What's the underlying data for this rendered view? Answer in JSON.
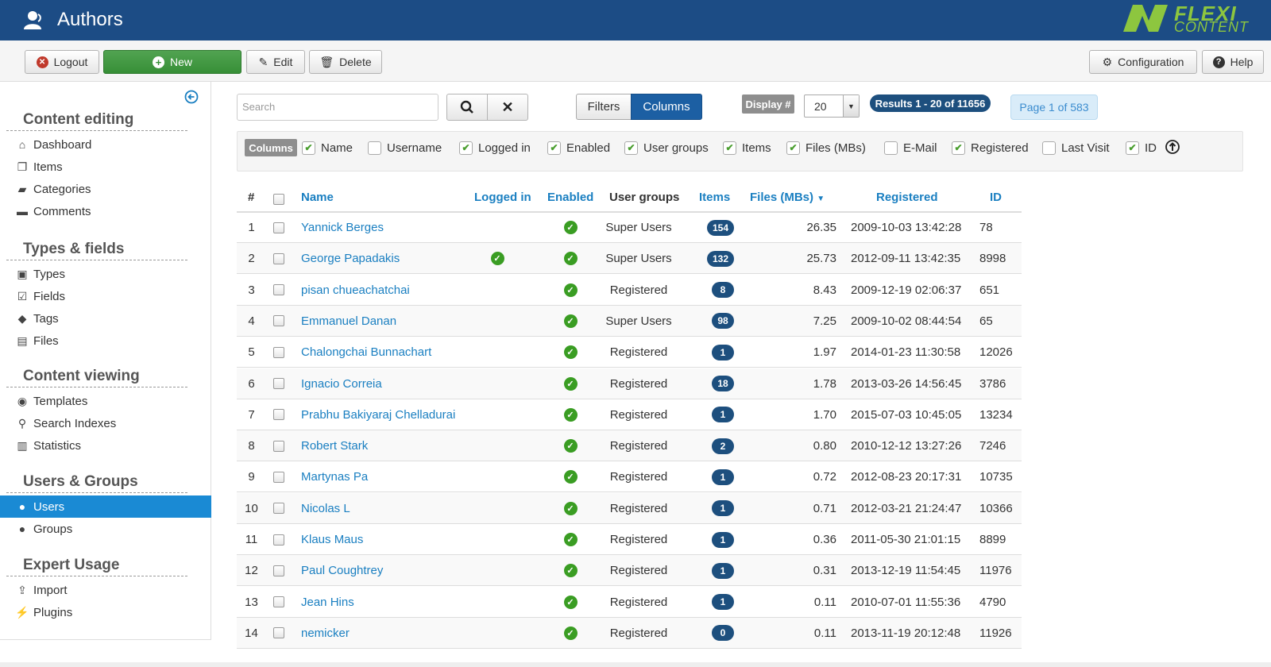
{
  "header": {
    "title": "Authors",
    "logo_top": "FLEXI",
    "logo_bottom": "CONTENT"
  },
  "toolbar": {
    "logout": "Logout",
    "new": "New",
    "edit": "Edit",
    "delete": "Delete",
    "configuration": "Configuration",
    "help": "Help"
  },
  "sidebar": {
    "sections": [
      {
        "title": "Content editing",
        "items": [
          {
            "label": "Dashboard",
            "icon": "home-icon"
          },
          {
            "label": "Items",
            "icon": "copy-icon"
          },
          {
            "label": "Categories",
            "icon": "folder-icon"
          },
          {
            "label": "Comments",
            "icon": "comment-icon"
          }
        ]
      },
      {
        "title": "Types & fields",
        "items": [
          {
            "label": "Types",
            "icon": "briefcase-icon"
          },
          {
            "label": "Fields",
            "icon": "checkbox-icon"
          },
          {
            "label": "Tags",
            "icon": "tags-icon"
          },
          {
            "label": "Files",
            "icon": "image-icon"
          }
        ]
      },
      {
        "title": "Content viewing",
        "items": [
          {
            "label": "Templates",
            "icon": "eye-icon"
          },
          {
            "label": "Search Indexes",
            "icon": "search-icon"
          },
          {
            "label": "Statistics",
            "icon": "chart-icon"
          }
        ]
      },
      {
        "title": "Users & Groups",
        "items": [
          {
            "label": "Users",
            "icon": "user-icon",
            "active": true
          },
          {
            "label": "Groups",
            "icon": "users-icon"
          }
        ]
      },
      {
        "title": "Expert Usage",
        "items": [
          {
            "label": "Import",
            "icon": "upload-icon"
          },
          {
            "label": "Plugins",
            "icon": "plug-icon"
          }
        ]
      }
    ]
  },
  "search": {
    "placeholder": "Search"
  },
  "view": {
    "filters": "Filters",
    "columns": "Columns"
  },
  "display": {
    "label": "Display #",
    "value": "20"
  },
  "results": {
    "text": "Results 1 - 20 of 11656",
    "page": "Page 1 of 583"
  },
  "columns_bar": {
    "label": "Columns",
    "options": [
      {
        "label": "Name",
        "checked": true
      },
      {
        "label": "Username",
        "checked": false
      },
      {
        "label": "Logged in",
        "checked": true
      },
      {
        "label": "Enabled",
        "checked": true
      },
      {
        "label": "User groups",
        "checked": true
      },
      {
        "label": "Items",
        "checked": true
      },
      {
        "label": "Files (MBs)",
        "checked": true
      },
      {
        "label": "E-Mail",
        "checked": false
      },
      {
        "label": "Registered",
        "checked": true
      },
      {
        "label": "Last Visit",
        "checked": false
      },
      {
        "label": "ID",
        "checked": true
      }
    ]
  },
  "table": {
    "headers": {
      "num": "#",
      "name": "Name",
      "logged": "Logged in",
      "enabled": "Enabled",
      "groups": "User groups",
      "items": "Items",
      "files": "Files (MBs)",
      "registered": "Registered",
      "id": "ID"
    },
    "rows": [
      {
        "num": "1",
        "name": "Yannick Berges",
        "logged": false,
        "enabled": true,
        "group": "Super Users",
        "items": "154",
        "files": "26.35",
        "registered": "2009-10-03 13:42:28",
        "id": "78"
      },
      {
        "num": "2",
        "name": "George Papadakis",
        "logged": true,
        "enabled": true,
        "group": "Super Users",
        "items": "132",
        "files": "25.73",
        "registered": "2012-09-11 13:42:35",
        "id": "8998"
      },
      {
        "num": "3",
        "name": "pisan chueachatchai",
        "logged": false,
        "enabled": true,
        "group": "Registered",
        "items": "8",
        "files": "8.43",
        "registered": "2009-12-19 02:06:37",
        "id": "651"
      },
      {
        "num": "4",
        "name": "Emmanuel Danan",
        "logged": false,
        "enabled": true,
        "group": "Super Users",
        "items": "98",
        "files": "7.25",
        "registered": "2009-10-02 08:44:54",
        "id": "65"
      },
      {
        "num": "5",
        "name": "Chalongchai Bunnachart",
        "logged": false,
        "enabled": true,
        "group": "Registered",
        "items": "1",
        "files": "1.97",
        "registered": "2014-01-23 11:30:58",
        "id": "12026"
      },
      {
        "num": "6",
        "name": "Ignacio Correia",
        "logged": false,
        "enabled": true,
        "group": "Registered",
        "items": "18",
        "files": "1.78",
        "registered": "2013-03-26 14:56:45",
        "id": "3786"
      },
      {
        "num": "7",
        "name": "Prabhu Bakiyaraj Chelladurai",
        "logged": false,
        "enabled": true,
        "group": "Registered",
        "items": "1",
        "files": "1.70",
        "registered": "2015-07-03 10:45:05",
        "id": "13234"
      },
      {
        "num": "8",
        "name": "Robert Stark",
        "logged": false,
        "enabled": true,
        "group": "Registered",
        "items": "2",
        "files": "0.80",
        "registered": "2010-12-12 13:27:26",
        "id": "7246"
      },
      {
        "num": "9",
        "name": "Martynas Pa",
        "logged": false,
        "enabled": true,
        "group": "Registered",
        "items": "1",
        "files": "0.72",
        "registered": "2012-08-23 20:17:31",
        "id": "10735"
      },
      {
        "num": "10",
        "name": "Nicolas L",
        "logged": false,
        "enabled": true,
        "group": "Registered",
        "items": "1",
        "files": "0.71",
        "registered": "2012-03-21 21:24:47",
        "id": "10366"
      },
      {
        "num": "11",
        "name": "Klaus Maus",
        "logged": false,
        "enabled": true,
        "group": "Registered",
        "items": "1",
        "files": "0.36",
        "registered": "2011-05-30 21:01:15",
        "id": "8899"
      },
      {
        "num": "12",
        "name": "Paul Coughtrey",
        "logged": false,
        "enabled": true,
        "group": "Registered",
        "items": "1",
        "files": "0.31",
        "registered": "2013-12-19 11:54:45",
        "id": "11976"
      },
      {
        "num": "13",
        "name": "Jean Hins",
        "logged": false,
        "enabled": true,
        "group": "Registered",
        "items": "1",
        "files": "0.11",
        "registered": "2010-07-01 11:55:36",
        "id": "4790"
      },
      {
        "num": "14",
        "name": "nemicker",
        "logged": false,
        "enabled": true,
        "group": "Registered",
        "items": "0",
        "files": "0.11",
        "registered": "2013-11-19 20:12:48",
        "id": "11926"
      }
    ]
  }
}
